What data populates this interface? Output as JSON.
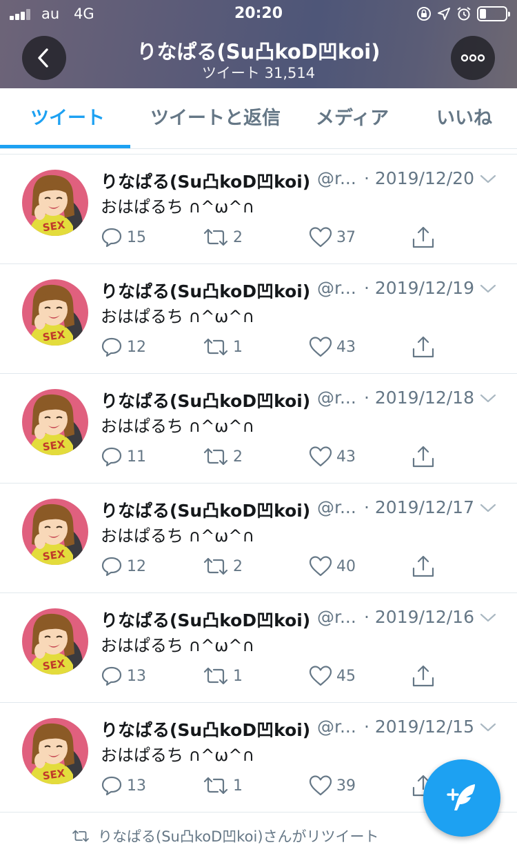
{
  "status_bar": {
    "carrier": "au",
    "network": "4G",
    "time": "20:20",
    "icons": [
      "rotation-lock-icon",
      "location-arrow-icon",
      "alarm-icon",
      "battery-icon"
    ]
  },
  "header": {
    "title": "りなぱる(Su凸koD凹koi)",
    "subtitle": "ツイート 31,514",
    "back_icon": "chevron-left-icon",
    "more_icon": "more-dots-icon"
  },
  "tabs": [
    {
      "label": "ツイート",
      "active": true
    },
    {
      "label": "ツイートと返信",
      "active": false
    },
    {
      "label": "メディア",
      "active": false
    },
    {
      "label": "いいね",
      "active": false
    }
  ],
  "tweets": [
    {
      "name": "りなぱる(Su凸koD凹koi)",
      "handle": "@r...",
      "date": "· 2019/12/20",
      "text": "おはぱるち ∩^ω^∩",
      "replies": "15",
      "retweets": "2",
      "likes": "37"
    },
    {
      "name": "りなぱる(Su凸koD凹koi)",
      "handle": "@r...",
      "date": "· 2019/12/19",
      "text": "おはぱるち ∩^ω^∩",
      "replies": "12",
      "retweets": "1",
      "likes": "43"
    },
    {
      "name": "りなぱる(Su凸koD凹koi)",
      "handle": "@r...",
      "date": "· 2019/12/18",
      "text": "おはぱるち ∩^ω^∩",
      "replies": "11",
      "retweets": "2",
      "likes": "43"
    },
    {
      "name": "りなぱる(Su凸koD凹koi)",
      "handle": "@r...",
      "date": "· 2019/12/17",
      "text": "おはぱるち ∩^ω^∩",
      "replies": "12",
      "retweets": "2",
      "likes": "40"
    },
    {
      "name": "りなぱる(Su凸koD凹koi)",
      "handle": "@r...",
      "date": "· 2019/12/16",
      "text": "おはぱるち ∩^ω^∩",
      "replies": "13",
      "retweets": "1",
      "likes": "45"
    },
    {
      "name": "りなぱる(Su凸koD凹koi)",
      "handle": "@r...",
      "date": "· 2019/12/15",
      "text": "おはぱるち ∩^ω^∩",
      "replies": "13",
      "retweets": "1",
      "likes": "39"
    }
  ],
  "avatar_label": "SEX",
  "retweet_note": "りなぱる(Su凸koD凹koi)さんがリツイート",
  "fab_icon": "compose-feather-icon",
  "colors": {
    "accent": "#1da1f2",
    "secondary_text": "#657786",
    "divider": "#e1e8ed",
    "avatar_bg": "#e0607e"
  }
}
